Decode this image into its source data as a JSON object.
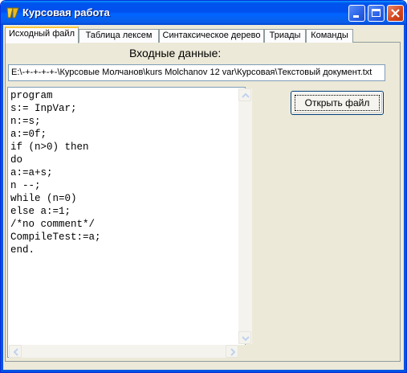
{
  "window": {
    "title": "Курсовая работа",
    "icon": "delphi-app-icon",
    "controls": [
      "minimize-icon",
      "maximize-icon",
      "close-icon"
    ]
  },
  "tabs": [
    {
      "label": "Исходный файл",
      "active": true
    },
    {
      "label": "Таблица лексем",
      "active": false
    },
    {
      "label": "Синтаксическое дерево",
      "active": false
    },
    {
      "label": "Триады",
      "active": false
    },
    {
      "label": "Команды",
      "active": false
    }
  ],
  "input": {
    "label": "Входные данные:",
    "path": "E:\\-+-+-+-+-\\Курсовые Молчанов\\kurs Molchanov 12 var\\Курсовая\\Текстовый документ.txt"
  },
  "open_button": {
    "label": "Открыть файл"
  },
  "source_code": [
    "program",
    "s:= InpVar;",
    "n:=s;",
    "a:=0f;",
    "if (n>0) then",
    "do",
    "a:=a+s;",
    "n --;",
    "while (n=0)",
    "else a:=1;",
    "/*no comment*/",
    "CompileTest:=a;",
    "end."
  ],
  "colors": {
    "titlebar": "#0054e3",
    "window_bg": "#ece9d8",
    "active_tab_accent": "#ffc83c",
    "close_button": "#d2431c"
  }
}
